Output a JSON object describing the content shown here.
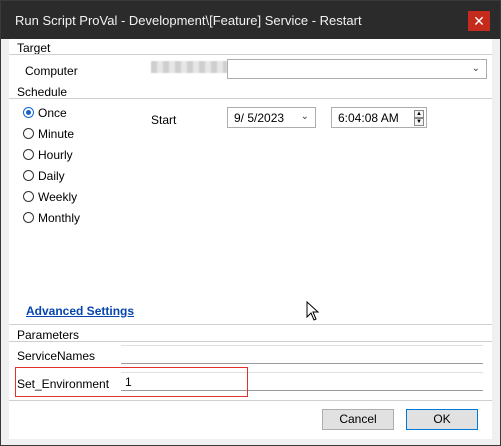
{
  "window": {
    "title": "Run Script ProVal - Development\\[Feature] Service - Restart",
    "close_glyph": "✕"
  },
  "target": {
    "section_label": "Target",
    "computer_label": "Computer",
    "computer_value": "",
    "computer_arrow": "⌄"
  },
  "schedule": {
    "section_label": "Schedule",
    "options": [
      {
        "label": "Once",
        "checked": true
      },
      {
        "label": "Minute",
        "checked": false
      },
      {
        "label": "Hourly",
        "checked": false
      },
      {
        "label": "Daily",
        "checked": false
      },
      {
        "label": "Weekly",
        "checked": false
      },
      {
        "label": "Monthly",
        "checked": false
      }
    ],
    "start_label": "Start",
    "date_value": "9/  5/2023",
    "date_arrow": "⌄",
    "time_value": "6:04:08 AM",
    "spin_up": "▲",
    "spin_down": "▼"
  },
  "advanced_settings_link": "Advanced Settings",
  "parameters": {
    "section_label": "Parameters",
    "fields": [
      {
        "label": "ServiceNames",
        "value": ""
      },
      {
        "label": "Set_Environment",
        "value": "1"
      }
    ]
  },
  "buttons": {
    "cancel": "Cancel",
    "ok": "OK"
  },
  "colors": {
    "titlebar": "#2b2b2b",
    "close": "#c42b1c",
    "link": "#0645ad",
    "highlight": "#e03030",
    "radio_accent": "#1464c8"
  }
}
